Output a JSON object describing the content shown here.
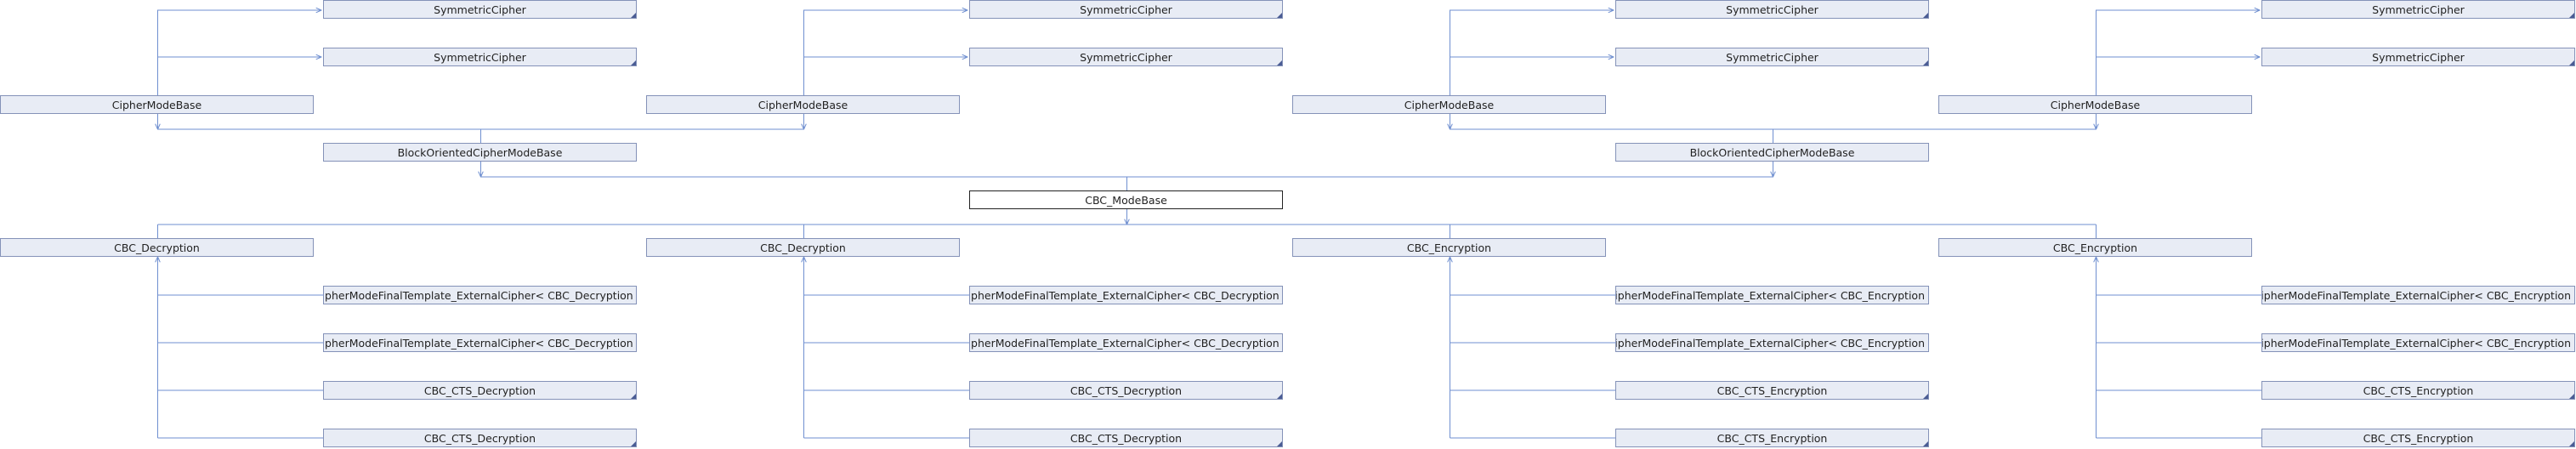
{
  "diagram": {
    "focus_node": "CBC_ModeBase",
    "bases": {
      "symmetric_cipher": "SymmetricCipher",
      "cipher_mode_base": "CipherModeBase",
      "block_oriented_cipher_mode_base": "BlockOrientedCipherModeBase"
    },
    "derived": {
      "cbc_decryption": "CBC_Decryption",
      "cbc_encryption": "CBC_Encryption",
      "final_template_decryption": "CipherModeFinalTemplate_ExternalCipher< CBC_Decryption >",
      "final_template_encryption": "CipherModeFinalTemplate_ExternalCipher< CBC_Encryption >",
      "cbc_cts_decryption": "CBC_CTS_Decryption",
      "cbc_cts_encryption": "CBC_CTS_Encryption"
    },
    "colors": {
      "edge": "#6f8fd0",
      "node_fill": "#e8ecf5",
      "node_border": "#8492b8",
      "focus_fill": "#ffffff",
      "focus_border": "#222222"
    }
  }
}
